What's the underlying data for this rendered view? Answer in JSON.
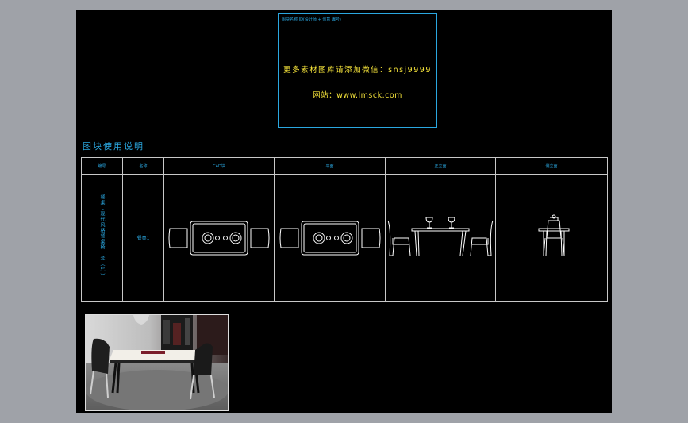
{
  "info_box": {
    "tiny_text": "图块名称 ID(设计师 + 创意 编号)",
    "line1": "更多素材图库请添加微信：snsj9999",
    "line2": "网站：www.lmsck.com"
  },
  "section_title": "图块使用说明",
  "table": {
    "headers": [
      "编号",
      "名称",
      "CAD块",
      "平面",
      "正立面",
      "侧立面"
    ],
    "row": {
      "number": "餐桌（现代风格餐桌椅一套（1））",
      "name": "餐桌1"
    }
  },
  "colors": {
    "accent": "#2aa7e0",
    "highlight": "#f4e23a",
    "line": "#c8c8c8",
    "background": "#000000",
    "frame": "#9fa2a8"
  },
  "photo": {
    "icon": "dining-room-photo"
  }
}
